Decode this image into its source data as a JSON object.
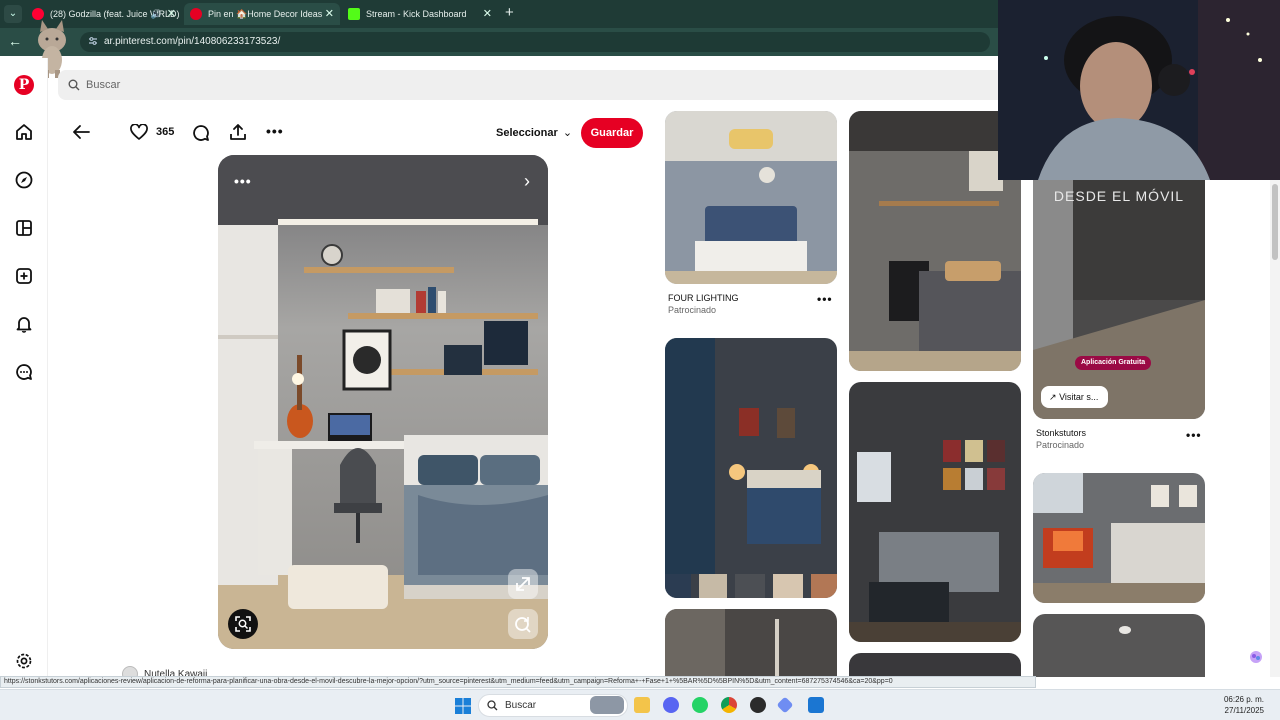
{
  "browser": {
    "tabs": [
      {
        "label": "(28) Godzilla (feat. Juice WRLD)",
        "fav_color": "#ff0033",
        "active": false
      },
      {
        "label": "Pin en 🏠Home Decor Ideas",
        "fav_color": "#e60023",
        "active": true
      },
      {
        "label": "Stream - Kick Dashboard",
        "fav_color": "#53fc18",
        "active": false
      }
    ],
    "url": "ar.pinterest.com/pin/140806233173523/",
    "status_url": "https://stonkstutors.com/aplicaciones-review/aplicacion-de-reforma-para-planificar-una-obra-desde-el-movil-descubre-la-mejor-opcion/?utm_source=pinterest&utm_medium=feed&utm_campaign=Reforma+-+Fase+1+%5BAR%5D%5BPIN%5D&utm_content=687275374546&ca=20&pp=0"
  },
  "pinterest": {
    "brand_color": "#e60023",
    "search_placeholder": "Buscar",
    "rail_icons": [
      "pinterest-logo",
      "home-icon",
      "explore-icon",
      "boards-icon",
      "create-icon",
      "notifications-icon",
      "messages-icon",
      "settings-icon"
    ],
    "pin": {
      "like_count": "365",
      "select_label": "Seleccionar",
      "save_label": "Guardar",
      "author": "Nutella Kawaii"
    },
    "feed": [
      {
        "title": "FOUR LIGHTING",
        "subtitle": "Patrocinado"
      },
      {
        "title": "Stonkstutors",
        "subtitle": "Patrocinado",
        "overlay": "DESDE EL MÓVIL",
        "badge": "Aplicación Gratuita",
        "visit": "Visitar s..."
      }
    ]
  },
  "taskbar": {
    "search_label": "Buscar",
    "time": "06:26 p. m.",
    "date": "27/11/2025"
  }
}
